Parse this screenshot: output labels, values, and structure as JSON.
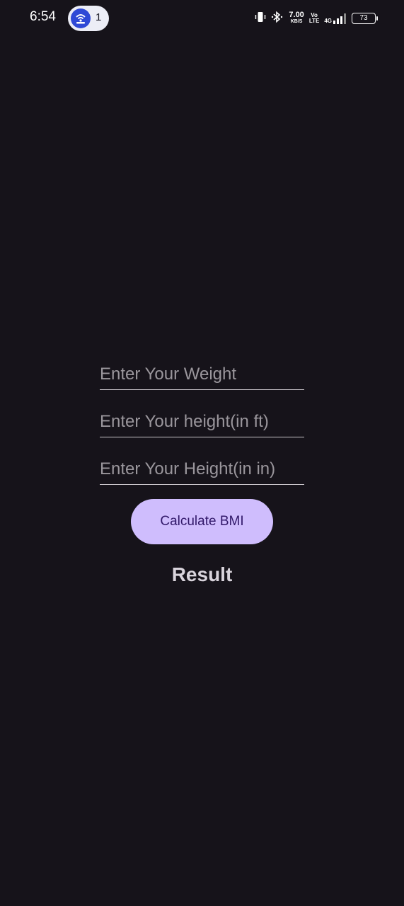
{
  "status_bar": {
    "time": "6:54",
    "hotspot_count": "1",
    "network_speed_value": "7.00",
    "network_speed_unit": "KB/S",
    "volte_top": "Vo",
    "volte_bottom": "LTE",
    "network_type": "4G",
    "battery_level": "73"
  },
  "form": {
    "weight_placeholder": "Enter Your Weight",
    "height_ft_placeholder": "Enter Your height(in ft)",
    "height_in_placeholder": "Enter Your Height(in in)",
    "calculate_label": "Calculate BMI",
    "result_label": "Result"
  },
  "colors": {
    "background": "#16131a",
    "button": "#cfbdfd",
    "button_text": "#32196a",
    "hotspot_accent": "#2f49d6"
  }
}
